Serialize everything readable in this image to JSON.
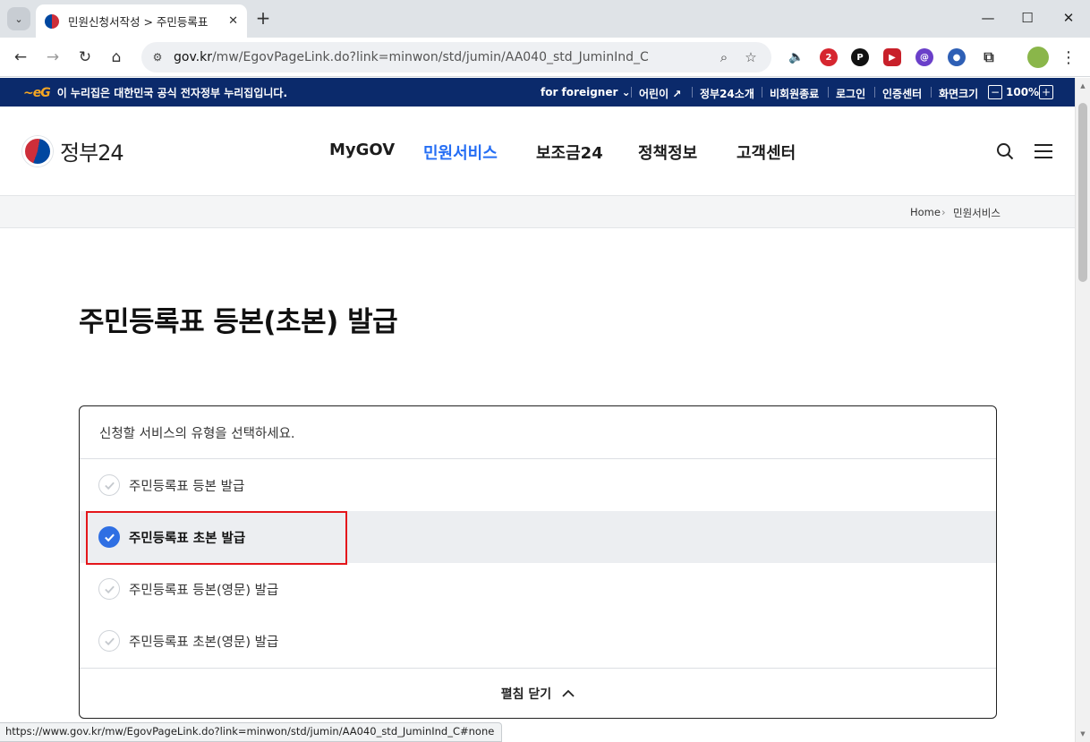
{
  "browser": {
    "tab_title": "민원신청서작성 > 주민등록표",
    "url_domain": "gov.kr",
    "url_path": "/mw/EgovPageLink.do?link=minwon/std/jumin/AA040_std_JuminInd_C",
    "status_url": "https://www.gov.kr/mw/EgovPageLink.do?link=minwon/std/jumin/AA040_std_JuminInd_C#none",
    "extension_badge": "2"
  },
  "gov_strip": {
    "notice": "이 누리집은 대한민국 공식 전자정부 누리집입니다.",
    "foreigner": "for foreigner",
    "kids": "어린이",
    "about": "정부24소개",
    "logout": "비회원종료",
    "login": "로그인",
    "cert": "인증센터",
    "screen_size": "화면크기",
    "zoom_level": "100%"
  },
  "header": {
    "logo_text": "정부24",
    "nav": [
      "MyGOV",
      "민원서비스",
      "보조금24",
      "정책정보",
      "고객센터"
    ]
  },
  "breadcrumb": {
    "home": "Home",
    "current": "민원서비스"
  },
  "page": {
    "title": "주민등록표 등본(초본) 발급",
    "prompt": "신청할 서비스의 유형을 선택하세요.",
    "options": [
      {
        "label": "주민등록표 등본 발급",
        "selected": false
      },
      {
        "label": "주민등록표 초본 발급",
        "selected": true
      },
      {
        "label": "주민등록표 등본(영문) 발급",
        "selected": false
      },
      {
        "label": "주민등록표 초본(영문) 발급",
        "selected": false
      }
    ],
    "toggle_label": "펼침 닫기"
  },
  "colors": {
    "accent": "#256ef4",
    "gov_strip": "#0b2a6b",
    "highlight": "#e4161b",
    "selected_check": "#2f6fe3"
  }
}
